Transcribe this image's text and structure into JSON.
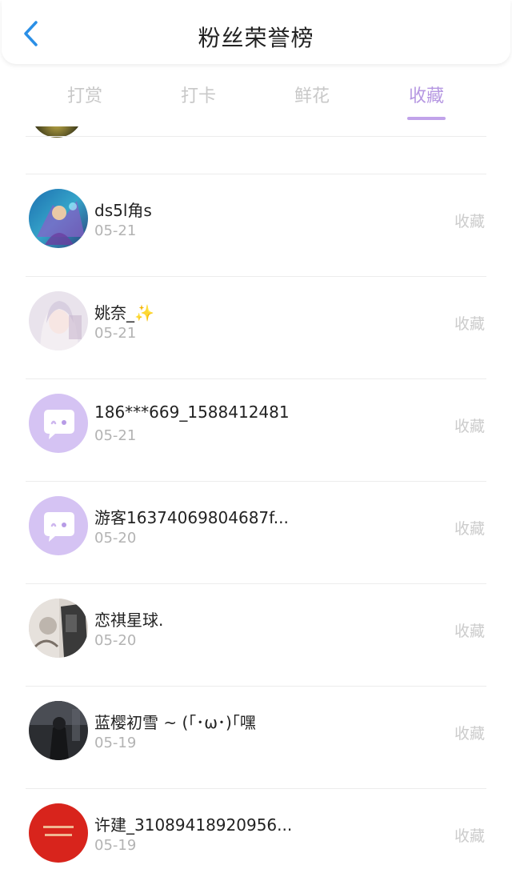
{
  "header": {
    "title": "粉丝荣誉榜"
  },
  "tabs": [
    {
      "label": "打赏",
      "active": false
    },
    {
      "label": "打卡",
      "active": false
    },
    {
      "label": "鲜花",
      "active": false
    },
    {
      "label": "收藏",
      "active": true
    }
  ],
  "colors": {
    "accent": "#b698e2",
    "default_avatar": "#d5c3f3"
  },
  "list": [
    {
      "name": "ds5l角s",
      "date": "05-21",
      "action": "收藏",
      "avatar": "game-art-avatar"
    },
    {
      "name": "姚奈_✨",
      "date": "05-21",
      "action": "收藏",
      "avatar": "anime-girl-avatar"
    },
    {
      "name": "186***669_1588412481",
      "date": "05-21",
      "action": "收藏",
      "avatar": "default-chat-avatar"
    },
    {
      "name": "游客16374069804687f...",
      "date": "05-20",
      "action": "收藏",
      "avatar": "default-chat-avatar"
    },
    {
      "name": "恋祺星球.",
      "date": "05-20",
      "action": "收藏",
      "avatar": "photo-avatar"
    },
    {
      "name": "蓝樱初雪 ~ (｢･ω･)｢嘿",
      "date": "05-19",
      "action": "收藏",
      "avatar": "dark-photo-avatar"
    },
    {
      "name": "许建_31089418920956...",
      "date": "05-19",
      "action": "收藏",
      "avatar": "red-badge-avatar"
    }
  ]
}
